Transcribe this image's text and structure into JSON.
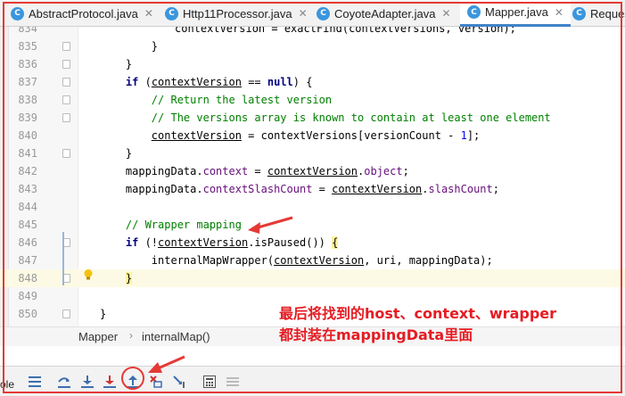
{
  "tabs": [
    {
      "label": "AbstractProtocol.java",
      "icon": "C",
      "active": false
    },
    {
      "label": "Http11Processor.java",
      "icon": "C",
      "active": false
    },
    {
      "label": "CoyoteAdapter.java",
      "icon": "C",
      "active": false
    },
    {
      "label": "Mapper.java",
      "icon": "C",
      "active": true
    },
    {
      "label": "Reques",
      "icon": "C",
      "active": false
    }
  ],
  "editor": {
    "top_fragment": "contextVersion = exactFind(contextVersions, version);",
    "line_numbers": [
      "834",
      "835",
      "836",
      "837",
      "838",
      "839",
      "840",
      "841",
      "842",
      "843",
      "844",
      "845",
      "846",
      "847",
      "848",
      "849",
      "850"
    ],
    "current_line": "848"
  },
  "annotation": {
    "line1": "最后将找到的host、context、wrapper",
    "line2": "都封装在mappingData里面"
  },
  "breadcrumb": {
    "class_name": "Mapper",
    "method_name": "internalMap()",
    "separator": "›"
  },
  "toolbar": {
    "left_label": "ole",
    "tools": [
      {
        "name": "show-execution-point",
        "icon": "menu-lines-icon"
      },
      {
        "name": "step-over",
        "icon": "step-over-icon"
      },
      {
        "name": "step-into",
        "icon": "step-into-icon"
      },
      {
        "name": "force-step-into",
        "icon": "force-step-into-icon"
      },
      {
        "name": "step-out",
        "icon": "step-out-icon"
      },
      {
        "name": "drop-frame",
        "icon": "drop-frame-icon"
      },
      {
        "name": "run-to-cursor",
        "icon": "run-to-cursor-icon"
      },
      {
        "name": "evaluate-expression",
        "icon": "calculator-icon"
      },
      {
        "name": "trace",
        "icon": "trace-icon"
      }
    ]
  },
  "colors": {
    "annotation_red": "#e51c23",
    "keyword": "#000080",
    "comment": "#008000",
    "field": "#660e7a",
    "number": "#0000ff",
    "active_tab_accent": "#4083c9",
    "current_line_bg": "#fcfae4"
  }
}
